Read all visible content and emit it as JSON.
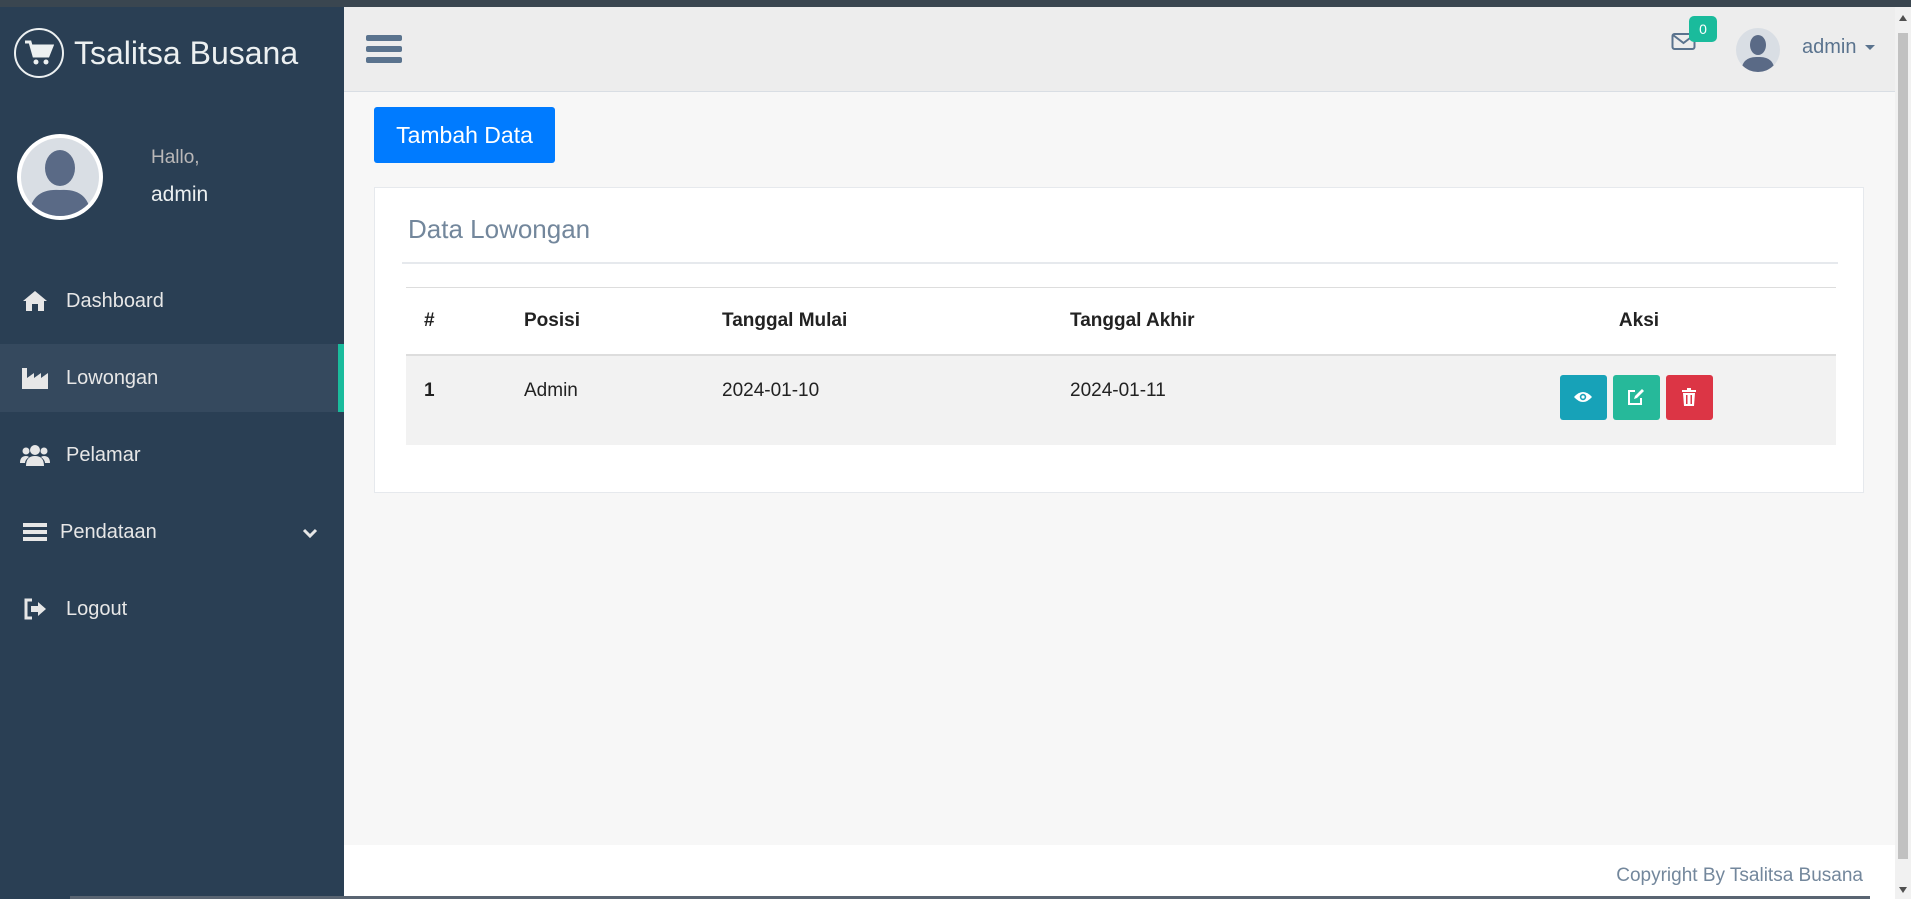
{
  "brand": {
    "title": "Tsalitsa Busana",
    "icon": "shopping-cart-icon"
  },
  "profile": {
    "greeting": "Hallo,",
    "name": "admin"
  },
  "sidebar": {
    "items": [
      {
        "label": "Dashboard",
        "icon": "home-icon"
      },
      {
        "label": "Lowongan",
        "icon": "industry-icon",
        "active": true
      },
      {
        "label": "Pelamar",
        "icon": "users-icon"
      },
      {
        "label": "Pendataan",
        "icon": "bars-icon",
        "has_submenu": true
      },
      {
        "label": "Logout",
        "icon": "sign-out-icon"
      }
    ]
  },
  "topnav": {
    "mail_count": "0",
    "user": "admin"
  },
  "main": {
    "add_button": "Tambah Data",
    "panel_title": "Data Lowongan",
    "table": {
      "headers": [
        "#",
        "Posisi",
        "Tanggal Mulai",
        "Tanggal Akhir",
        "Aksi"
      ],
      "rows": [
        {
          "num": "1",
          "posisi": "Admin",
          "mulai": "2024-01-10",
          "akhir": "2024-01-11"
        }
      ]
    }
  },
  "footer": {
    "text": "Copyright By Tsalitsa Busana"
  },
  "colors": {
    "sidebar": "#2a3f54",
    "accent": "#1abb9c",
    "primary": "#007bff",
    "info": "#17a2b8",
    "success": "#26b99a",
    "danger": "#dc3545"
  }
}
